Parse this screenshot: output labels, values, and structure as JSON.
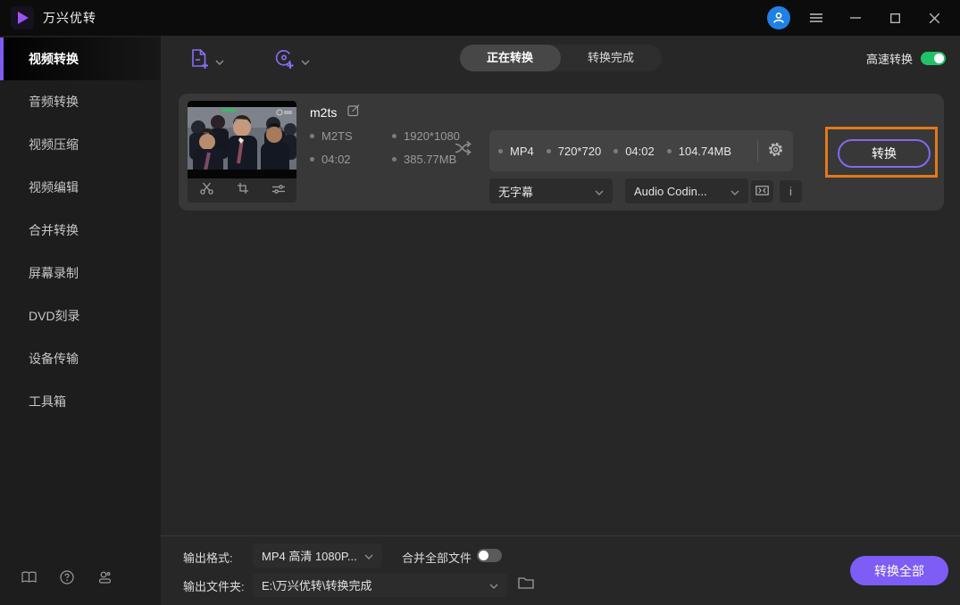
{
  "titlebar": {
    "title": "万兴优转"
  },
  "sidebar": {
    "items": [
      {
        "label": "视频转换",
        "active": true
      },
      {
        "label": "音频转换",
        "active": false
      },
      {
        "label": "视频压缩",
        "active": false
      },
      {
        "label": "视频编辑",
        "active": false
      },
      {
        "label": "合并转换",
        "active": false
      },
      {
        "label": "屏幕录制",
        "active": false
      },
      {
        "label": "DVD刻录",
        "active": false
      },
      {
        "label": "设备传输",
        "active": false
      },
      {
        "label": "工具箱",
        "active": false
      }
    ]
  },
  "toolbar": {
    "tab_converting": "正在转换",
    "tab_finished": "转换完成",
    "active_tab": "正在转换",
    "speed_label": "高速转换",
    "speed_on": true
  },
  "file_card": {
    "name": "m2ts",
    "source": {
      "format": "M2TS",
      "resolution": "1920*1080",
      "duration": "04:02",
      "size": "385.77MB"
    },
    "output": {
      "format": "MP4",
      "resolution": "720*720",
      "duration": "04:02",
      "size": "104.74MB"
    },
    "subtitle_value": "无字幕",
    "audio_value": "Audio Codin...",
    "info_glyph": "i",
    "convert_label": "转换"
  },
  "footer": {
    "output_format_label": "输出格式:",
    "output_format_value": "MP4 高清 1080P...",
    "merge_label": "合并全部文件",
    "merge_on": false,
    "output_folder_label": "输出文件夹:",
    "output_folder_value": "E:\\万兴优转\\转换完成",
    "convert_all_label": "转换全部"
  },
  "icons": [
    "app-logo-play-icon",
    "user-avatar-icon",
    "menu-icon",
    "minimize-icon",
    "maximize-icon",
    "close-icon",
    "add-file-icon",
    "add-disc-icon",
    "chevron-down-icon",
    "edit-icon",
    "scissors-icon",
    "crop-icon",
    "effects-sliders-icon",
    "shuffle-icon",
    "gear-icon",
    "compress-icon",
    "info-icon",
    "folder-icon",
    "book-icon",
    "help-icon",
    "contact-icon"
  ],
  "colors": {
    "accent_purple": "#7e5cf6",
    "toggle_green": "#22c164",
    "highlight_orange": "#e2791a",
    "avatar_blue": "#2080e8",
    "titlebar_bg": "#0c0c0c",
    "sidebar_bg": "#1d1d1d",
    "main_bg": "#272727",
    "card_bg": "#383838"
  }
}
